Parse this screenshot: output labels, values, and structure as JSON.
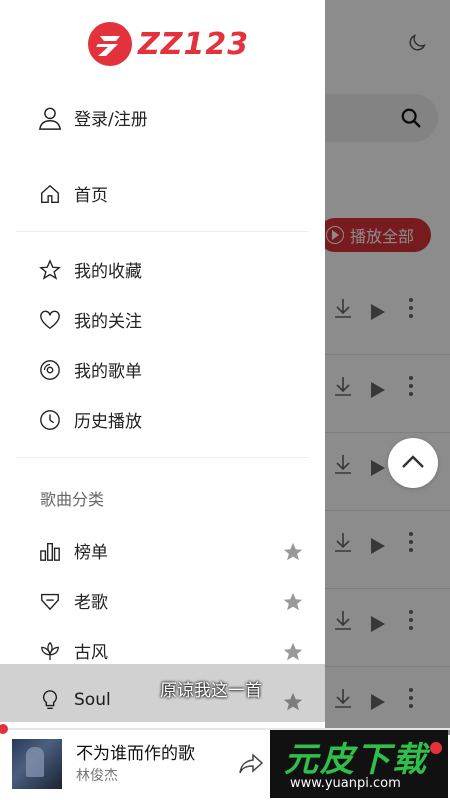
{
  "app": {
    "logo_text": "ZZ123",
    "brand_color": "#e3323b"
  },
  "background": {
    "play_all_label": "播放全部",
    "rows": 6
  },
  "drawer": {
    "login_label": "登录/注册",
    "home_label": "首页",
    "personal_items": [
      {
        "label": "我的收藏",
        "icon": "star-outline-icon"
      },
      {
        "label": "我的关注",
        "icon": "heart-outline-icon"
      },
      {
        "label": "我的歌单",
        "icon": "disc-icon"
      },
      {
        "label": "历史播放",
        "icon": "clock-icon"
      }
    ],
    "section_title": "歌曲分类",
    "categories": [
      {
        "label": "榜单",
        "icon": "bar-chart-icon"
      },
      {
        "label": "老歌",
        "icon": "tag-icon"
      },
      {
        "label": "古风",
        "icon": "lotus-icon"
      },
      {
        "label": "Soul",
        "icon": "bulb-icon"
      }
    ]
  },
  "caption": {
    "text": "原谅我这一首"
  },
  "player": {
    "title": "不为谁而作的歌",
    "artist": "林俊杰"
  },
  "watermark": {
    "cn": "元皮下载",
    "url": "www.yuanpi.com"
  }
}
